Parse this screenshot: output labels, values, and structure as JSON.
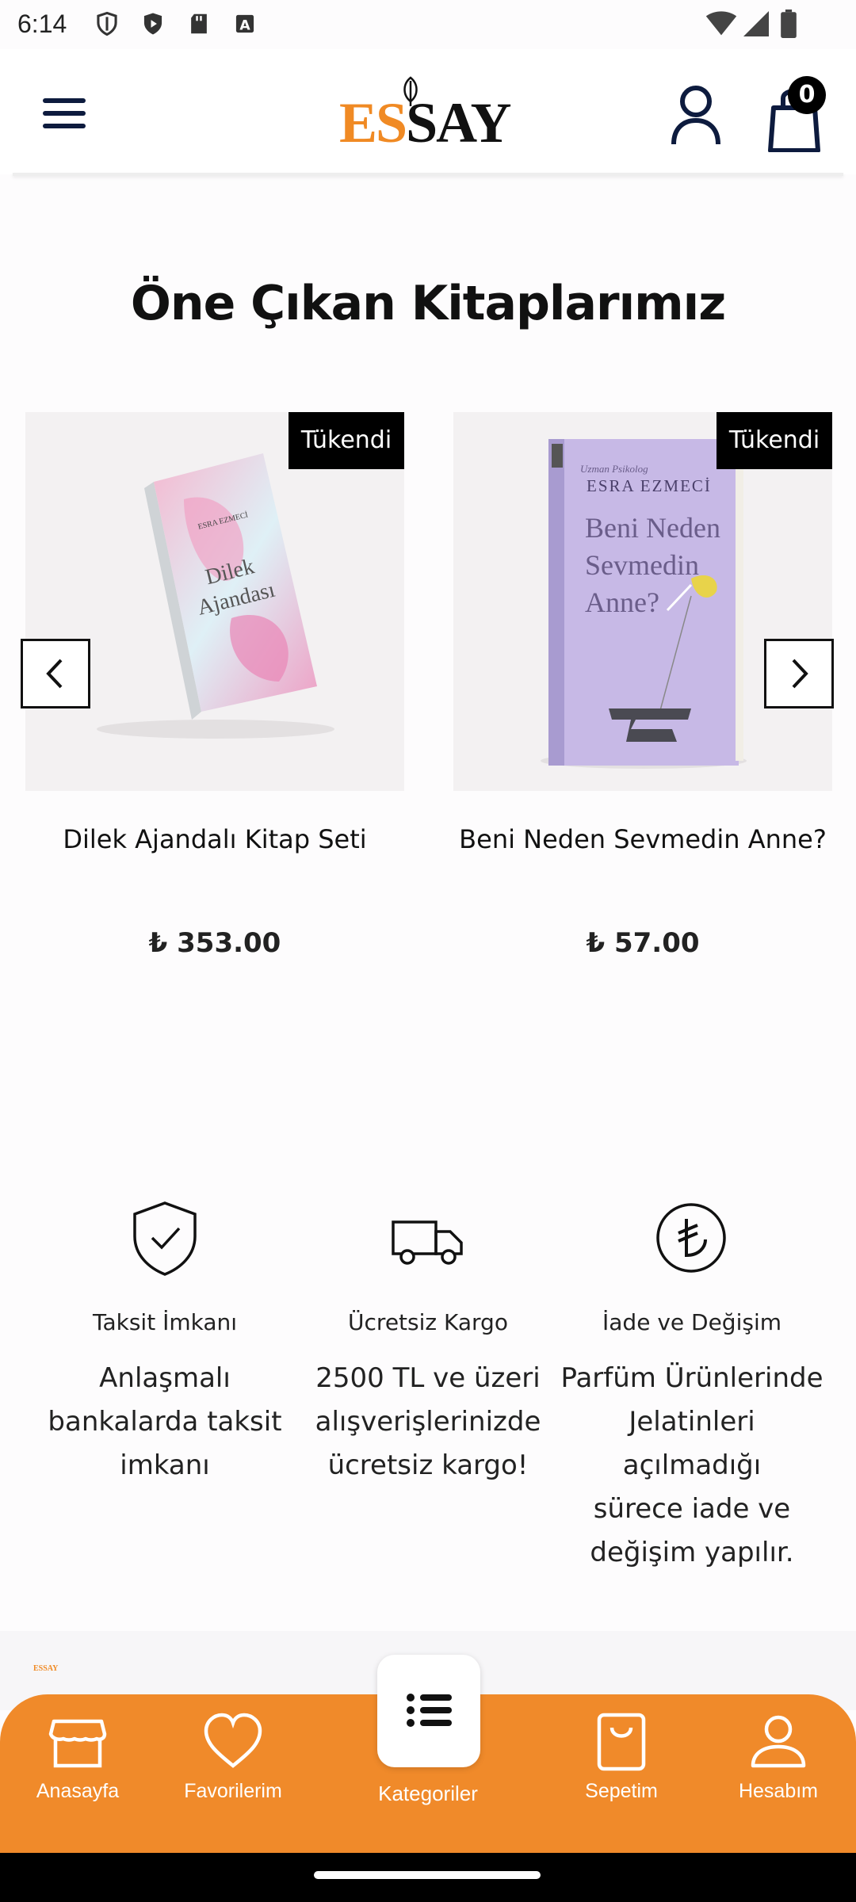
{
  "status_bar": {
    "time": "6:14",
    "icons_left": [
      "shield-outline-icon",
      "play-shield-icon",
      "sd-card-icon",
      "font-icon"
    ],
    "icons_right": [
      "wifi-icon",
      "signal-icon",
      "battery-icon"
    ]
  },
  "header": {
    "logo_es": "ES",
    "logo_say": "SAY",
    "cart_count": "0",
    "brand_color": "#f08a24"
  },
  "section": {
    "title": "Öne Çıkan Kitaplarımız"
  },
  "products": [
    {
      "badge": "Tükendi",
      "name": "Dilek Ajandalı Kitap Seti",
      "price": "₺ 353.00",
      "cover_title_1": "Dilek",
      "cover_title_2": "Ajandası",
      "cover_author": "ESRA EZMECİ"
    },
    {
      "badge": "Tükendi",
      "name": "Beni Neden Sevmedin Anne?",
      "price": "₺ 57.00",
      "cover_kicker": "Uzman Psikolog",
      "cover_author": "ESRA EZMECİ",
      "cover_title_1": "Beni Neden",
      "cover_title_2": "Sevmedin",
      "cover_title_3": "Anne?"
    }
  ],
  "features": [
    {
      "icon": "shield-check-icon",
      "title": "Taksit İmkanı",
      "desc_lines": [
        "Anlaşmalı",
        "bankalarda taksit",
        "imkanı"
      ]
    },
    {
      "icon": "truck-icon",
      "title": "Ücretsiz Kargo",
      "desc_lines": [
        "2500 TL ve üzeri",
        "alışverişlerinizde",
        "ücretsiz kargo!"
      ]
    },
    {
      "icon": "lira-circle-icon",
      "title": "İade ve Değişim",
      "desc_lines": [
        "Parfüm Ürünlerinde",
        "Jelatinleri açılmadığı",
        "sürece iade ve",
        "değişim yapılır."
      ]
    }
  ],
  "footer": {
    "mini_logo": "ESSAY"
  },
  "bottom_nav": {
    "items": [
      {
        "label": "Anasayfa",
        "icon": "store-icon"
      },
      {
        "label": "Favorilerim",
        "icon": "heart-icon"
      },
      {
        "label": "Kategoriler",
        "icon": "list-icon"
      },
      {
        "label": "Sepetim",
        "icon": "bag-icon"
      },
      {
        "label": "Hesabım",
        "icon": "user-icon"
      }
    ],
    "bg_color": "#f08a2a"
  }
}
